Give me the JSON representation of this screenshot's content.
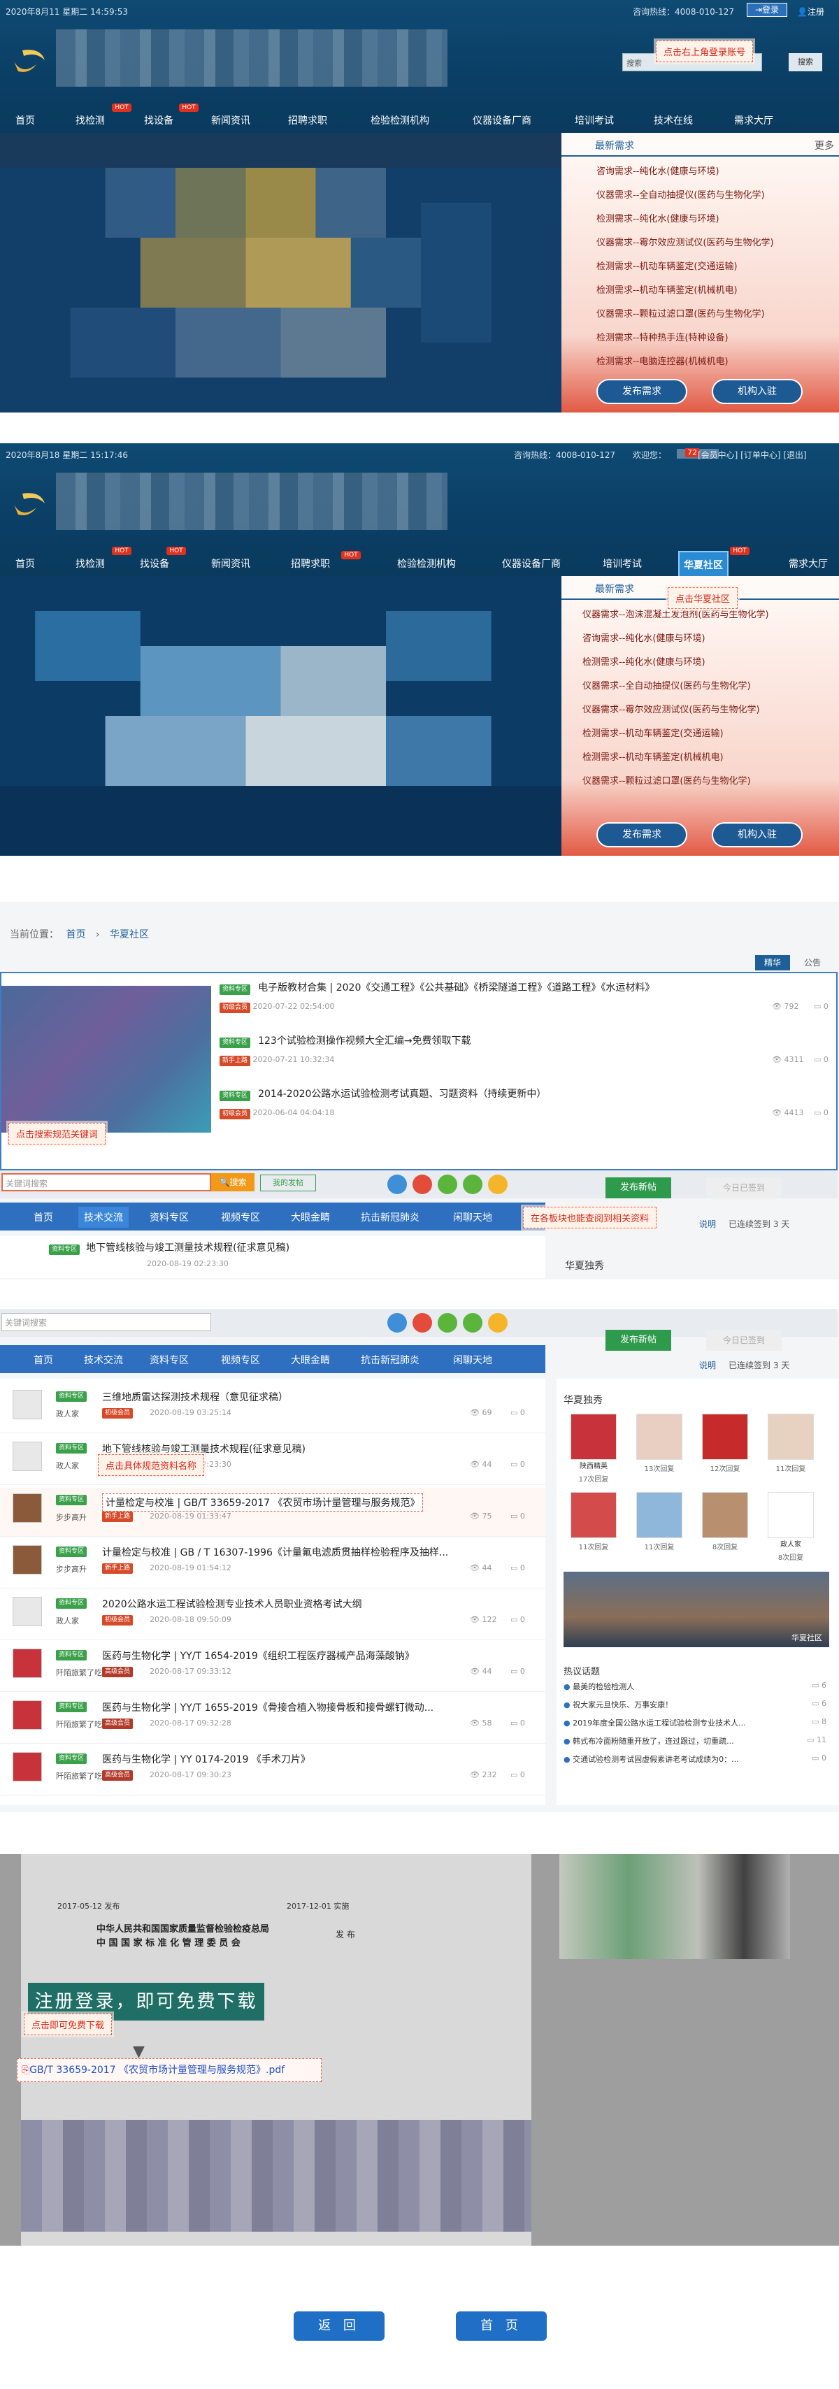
{
  "shot1": {
    "datetime": "2020年8月11 星期二 14:59:53",
    "hotline": "咨询热线：4008-010-127",
    "login_btn": "登录",
    "register_link": "注册",
    "search_label": "搜索",
    "search_btn": "搜索",
    "callout": "点击右上角登录账号",
    "nav": [
      "首页",
      "找检测",
      "找设备",
      "新闻资讯",
      "招聘求职",
      "检验检测机构",
      "仪器设备厂商",
      "培训考试",
      "技术在线",
      "需求大厅"
    ],
    "hot_badge": "HOT",
    "side_tab": "最新需求",
    "side_more": "更多",
    "demands": [
      "咨询需求--纯化水(健康与环境)",
      "仪器需求--全自动抽提仪(医药与生物化学)",
      "检测需求--纯化水(健康与环境)",
      "仪器需求--霉尔效应测试仪(医药与生物化学)",
      "检测需求--机动车辆鉴定(交通运输)",
      "检测需求--机动车辆鉴定(机械机电)",
      "仪器需求--颗粒过滤口罩(医药与生物化学)",
      "检测需求--特种热手连(特种设备)",
      "检测需求--电脑连控器(机械机电)"
    ],
    "publish_btn": "发布需求",
    "join_btn": "机构入驻"
  },
  "shot2": {
    "datetime": "2020年8月18 星期二 15:17:46",
    "hotline": "咨询热线：4008-010-127",
    "welcome": "欢迎您：",
    "msg_count": "72",
    "links": "[会员中心] [订单中心] [退出]",
    "nav": [
      "首页",
      "找检测",
      "找设备",
      "新闻资讯",
      "招聘求职",
      "检验检测机构",
      "仪器设备厂商",
      "培训考试",
      "华夏社区",
      "需求大厅"
    ],
    "callout": "点击华夏社区",
    "side_tab": "最新需求",
    "demands": [
      "仪器需求--泡沫混凝土发泡剂(医药与生物化学)",
      "咨询需求--纯化水(健康与环境)",
      "检测需求--纯化水(健康与环境)",
      "仪器需求--全自动抽提仪(医药与生物化学)",
      "仪器需求--霉尔效应测试仪(医药与生物化学)",
      "检测需求--机动车辆鉴定(交通运输)",
      "检测需求--机动车辆鉴定(机械机电)",
      "仪器需求--颗粒过滤口罩(医药与生物化学)"
    ],
    "publish_btn": "发布需求",
    "join_btn": "机构入驻"
  },
  "shot3": {
    "breadcrumb_label": "当前位置：",
    "crumb_home": "首页",
    "crumb_current": "华夏社区",
    "tabs": [
      "精华",
      "公告"
    ],
    "posts": [
      {
        "tag": "资料专区",
        "title": "电子版教材合集 | 2020《交通工程》《公共基础》《桥梁隧道工程》《道路工程》《水运材料》",
        "badge": "初级会员",
        "date": "2020-07-22 02:54:00",
        "views": "792",
        "comments": "0"
      },
      {
        "tag": "资料专区",
        "title": "123个试验检测操作视频大全汇编→免费领取下载",
        "badge": "新手上路",
        "date": "2020-07-21 10:32:34",
        "views": "4311",
        "comments": "0"
      },
      {
        "tag": "资料专区",
        "title": "2014-2020公路水运试验检测考试真题、习题资料（持续更新中）",
        "badge": "初级会员",
        "date": "2020-06-04 04:04:18",
        "views": "4413",
        "comments": "0"
      }
    ],
    "callout_search": "点击搜索规范关键词",
    "search_placeholder": "关键词搜索",
    "search_btn": "搜索",
    "my_posts": "我的发帖",
    "subnav": [
      "首页",
      "技术交流",
      "资料专区",
      "视频专区",
      "大眼金睛",
      "抗击新冠肺炎",
      "闲聊天地"
    ],
    "post_btn": "发布新帖",
    "checkin_btn": "今日已签到",
    "checkin_note": "已连续签到 3 天",
    "explain": "说明",
    "callout_board": "在各板块也能查阅到相关资料",
    "first_post": {
      "tag": "资料专区",
      "title": "地下管线核验与竣工测量技术规程(征求意见稿)",
      "date": "2020-08-19 02:23:30"
    },
    "side_title": "华夏独秀"
  },
  "shot4": {
    "search_placeholder": "关键词搜索",
    "subnav": [
      "首页",
      "技术交流",
      "资料专区",
      "视频专区",
      "大眼金睛",
      "抗击新冠肺炎",
      "闲聊天地"
    ],
    "post_btn": "发布新帖",
    "checkin_btn": "今日已签到",
    "explain": "说明",
    "checkin_note": "已连续签到 3 天",
    "callout": "点击具体规范资料名称",
    "posts": [
      {
        "tag": "资料专区",
        "title": "三维地质雷达探测技术规程（意见征求稿）",
        "user": "政人家",
        "badge": "初级会员",
        "date": "2020-08-19 03:25:14",
        "views": "69",
        "comments": "0"
      },
      {
        "tag": "资料专区",
        "title": "地下管线核验与竣工测量技术规程(征求意见稿)",
        "user": "政人家",
        "badge": "初级会员",
        "date": "2020-08-19 02:23:30",
        "views": "44",
        "comments": "0"
      },
      {
        "tag": "资料专区",
        "title": "计量检定与校准 | GB/T 33659-2017 《农贸市场计量管理与服务规范》",
        "user": "步步高升",
        "badge": "新手上路",
        "date": "2020-08-19 01:33:47",
        "views": "75",
        "comments": "0"
      },
      {
        "tag": "资料专区",
        "title": "计量检定与校准 | GB / T 16307-1996《计量氟电滤质贯抽样检验程序及抽样...",
        "user": "步步高升",
        "badge": "新手上路",
        "date": "2020-08-19 01:54:12",
        "views": "44",
        "comments": "0"
      },
      {
        "tag": "资料专区",
        "title": "2020公路水运工程试验检测专业技术人员职业资格考试大纲",
        "user": "政人家",
        "badge": "初级会员",
        "date": "2020-08-18 09:50:09",
        "views": "122",
        "comments": "0"
      },
      {
        "tag": "资料专区",
        "title": "医药与生物化学 | YY/T 1654-2019《组织工程医疗器械产品海藻酸钠》",
        "user": "阡陌旅繁了吃",
        "badge": "高级会员",
        "date": "2020-08-17 09:33:12",
        "views": "44",
        "comments": "0"
      },
      {
        "tag": "资料专区",
        "title": "医药与生物化学 | YY/T 1655-2019《骨接合植入物接骨板和接骨螺钉微动...",
        "user": "阡陌旅繁了吃",
        "badge": "高级会员",
        "date": "2020-08-17 09:32:28",
        "views": "58",
        "comments": "0"
      },
      {
        "tag": "资料专区",
        "title": "医药与生物化学 | YY 0174-2019 《手术刀片》",
        "user": "阡陌旅繁了吃",
        "badge": "高级会员",
        "date": "2020-08-17 09:30:23",
        "views": "232",
        "comments": "0"
      }
    ],
    "side_title": "华夏独秀",
    "members": [
      {
        "name": "陕西精英",
        "count": "17次回复"
      },
      {
        "name": "",
        "count": "13次回复"
      },
      {
        "name": "",
        "count": "12次回复"
      },
      {
        "name": "",
        "count": "11次回复"
      },
      {
        "name": "",
        "count": "11次回复"
      },
      {
        "name": "",
        "count": "11次回复"
      },
      {
        "name": "",
        "count": "8次回复"
      },
      {
        "name": "政人家",
        "count": "8次回复"
      }
    ],
    "hot_title": "热议话题",
    "hot_topics": [
      "最美的检验检测人",
      "祝大家元旦快乐、万事安康！",
      "2019年度全国公路水运工程试验检测专业技术人...",
      "韩式布冷面粉随重开放了，连过跟过，切重疏...",
      "交通试验检测考试固虚假素讲老考试成绩为0：..."
    ],
    "hot_counts": [
      "6",
      "6",
      "8",
      "11",
      "0"
    ],
    "photo_caption": "华夏社区"
  },
  "shot5": {
    "date_left": "2017-05-12 发布",
    "date_right": "2017-12-01 实施",
    "issuer1": "中华人民共和国国家质量监督检验检疫总局",
    "issuer2": "中 国 国 家 标 准 化 管 理 委 员 会",
    "issue_word": "发 布",
    "register_banner": "注册登录，即可免费下载",
    "callout": "点击即可免费下载",
    "file_link": "GB/T 33659-2017 《农贸市场计量管理与服务规范》.pdf"
  },
  "footer": {
    "back_btn": "返 回",
    "home_btn": "首 页"
  }
}
